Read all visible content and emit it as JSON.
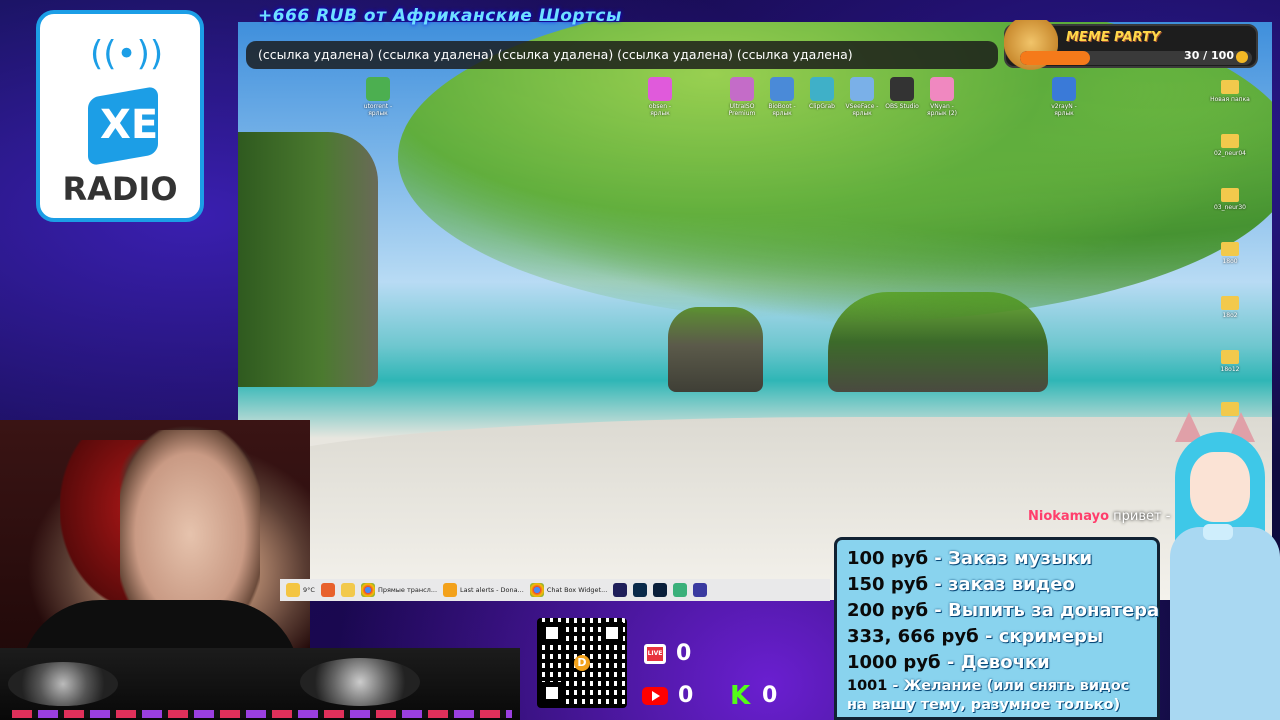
{
  "ticker": {
    "text": "+666 RUB  от  Африканские Шортсы"
  },
  "links_bar": {
    "text": "(ссылка удалена) (ссылка удалена) (ссылка удалена) (ссылка удалена) (ссылка удалена)"
  },
  "meme_party": {
    "title": "MEME PARTY",
    "count": "30 / 100",
    "progress": 0.3
  },
  "logo": {
    "line1": "XE",
    "line2": "RADIO"
  },
  "desktop_icons": [
    {
      "label": "utorrent - ярлык",
      "color": "#4caf50"
    },
    {
      "label": "obsen - ярлык",
      "color": "#e05adb"
    },
    {
      "label": "UltraISO Premium",
      "color": "#c46cc8"
    },
    {
      "label": "BioBoot - ярлык",
      "color": "#4a8ad8"
    },
    {
      "label": "ClipGrab",
      "color": "#3fb0c8"
    },
    {
      "label": "VSeeFace - ярлык",
      "color": "#7ab0e8"
    },
    {
      "label": "OBS Studio",
      "color": "#333333"
    },
    {
      "label": "VNyan - ярлык (2)",
      "color": "#f088c0"
    },
    {
      "label": "v2rayN - ярлык",
      "color": "#3a7ad8"
    }
  ],
  "folders": [
    "Новая папка",
    "02_neur04",
    "03_neur30",
    "18o0",
    "18o2",
    "18o12",
    ""
  ],
  "taskbar": {
    "weather": "9°C",
    "items": [
      "Прямые трансл...",
      "Last alerts - Dona...",
      "Chat Box Widget..."
    ],
    "app_icons": [
      "firefox-icon",
      "files-icon",
      "premiere-icon",
      "audition-icon",
      "photoshop-icon",
      "globe-icon",
      "save-icon"
    ]
  },
  "stats": {
    "live": "0",
    "youtube": "0",
    "kick": "0",
    "live_badge": "LIVE",
    "kick_letter": "K"
  },
  "qr": {
    "center_glyph": "D"
  },
  "prices": [
    {
      "amount": "100 руб",
      "desc": " - Заказ музыки"
    },
    {
      "amount": "150 руб",
      "desc": " - заказ видео"
    },
    {
      "amount": "200 руб",
      "desc": " - Выпить за донатера"
    },
    {
      "amount": "333, 666 руб",
      "desc": " - скримеры"
    },
    {
      "amount": "1000 руб",
      "desc": " - Девочки"
    },
    {
      "amount": "1001",
      "desc": " - Желание (или снять видос"
    }
  ],
  "prices_note": "на вашу тему, разумное только)",
  "chat": {
    "user": "Niokamayo",
    "message": " привет -"
  },
  "colors": {
    "accent": "#1c9ee6",
    "price_panel": "#89d3ee",
    "chat_user": "#ff3e6c",
    "meme_fill": "#f57a1a"
  }
}
